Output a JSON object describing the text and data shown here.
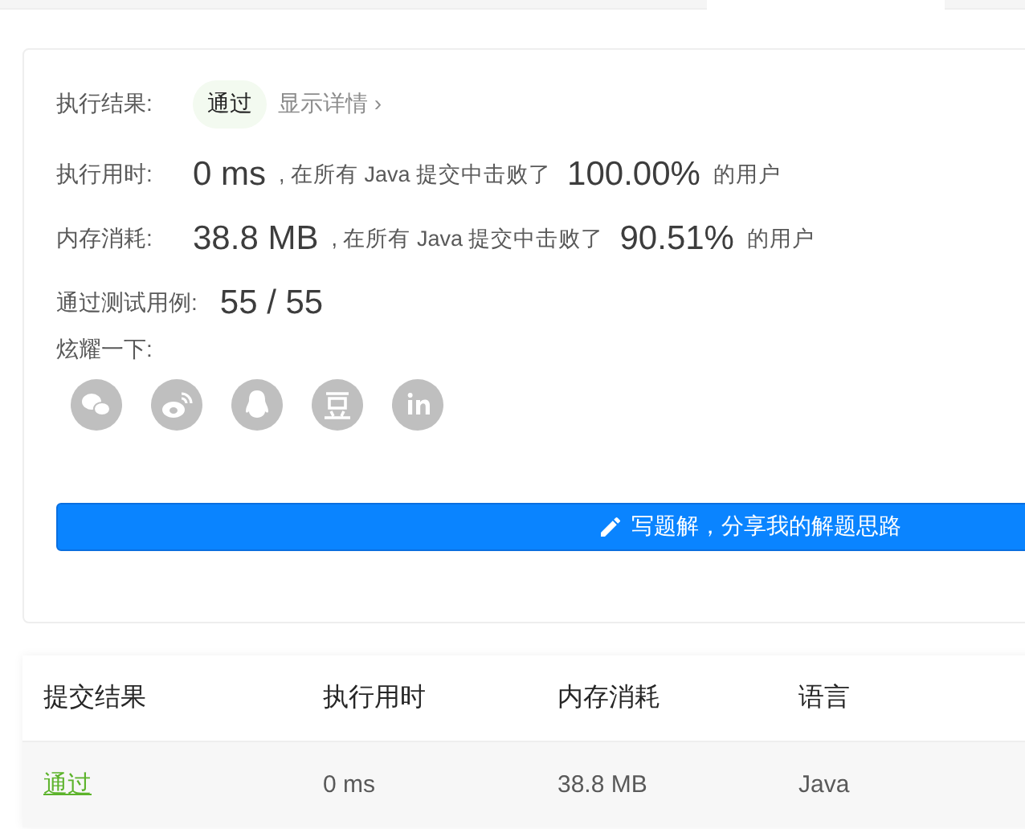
{
  "result": {
    "label": "执行结果:",
    "status": "通过",
    "details_link": "显示详情 ›"
  },
  "stats": [
    {
      "label": "执行用时:",
      "value": "0 ms",
      "mid": ", 在所有 Java 提交中击败了",
      "percent": "100.00%",
      "suffix": "的用户"
    },
    {
      "label": "内存消耗:",
      "value": "38.8 MB",
      "mid": ", 在所有 Java 提交中击败了",
      "percent": "90.51%",
      "suffix": "的用户"
    }
  ],
  "tests": {
    "label": "通过测试用例:",
    "value": "55 / 55"
  },
  "share": {
    "label": "炫耀一下:",
    "icons": [
      {
        "kind": "wechat"
      },
      {
        "kind": "weibo"
      },
      {
        "kind": "qq"
      },
      {
        "kind": "douban"
      },
      {
        "kind": "linkedin"
      }
    ]
  },
  "write_button": "写题解，分享我的解题思路",
  "table": {
    "columns": [
      "提交结果",
      "执行用时",
      "内存消耗",
      "语言"
    ],
    "rows": [
      {
        "status": "通过",
        "time": "0 ms",
        "memory": "38.8 MB",
        "language": "Java"
      }
    ]
  }
}
